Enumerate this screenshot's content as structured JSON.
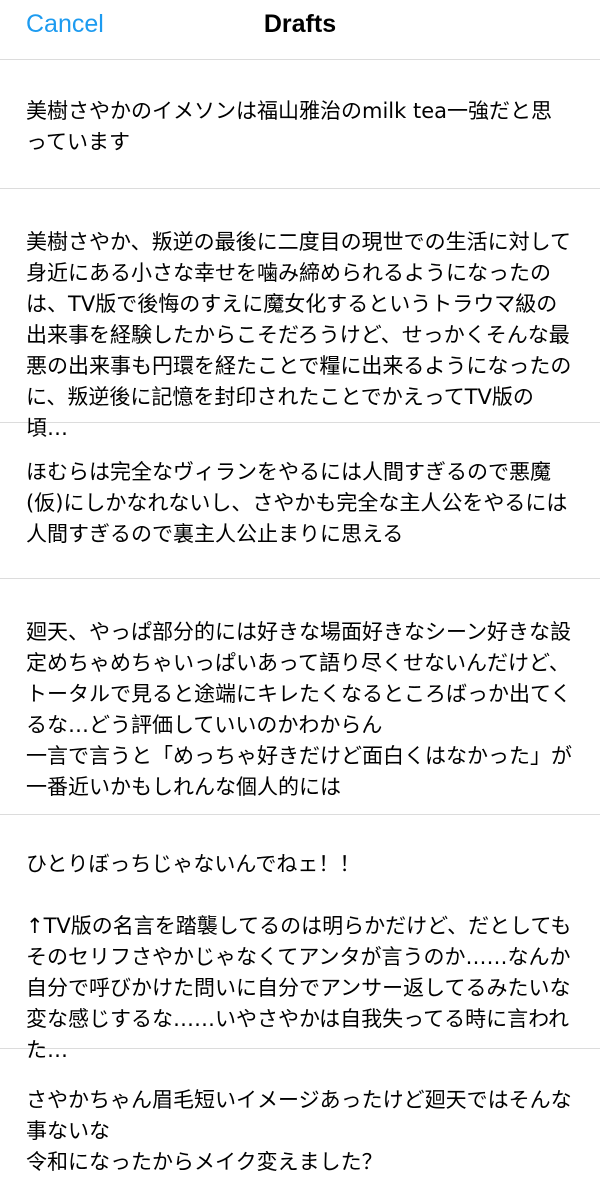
{
  "header": {
    "cancel_label": "Cancel",
    "title": "Drafts"
  },
  "drafts": [
    {
      "text": "美樹さやかのイメソンは福山雅治のmilk tea一強だと思っています"
    },
    {
      "text": "美樹さやか、叛逆の最後に二度目の現世での生活に対して身近にある小さな幸せを噛み締められるようになったのは、TV版で後悔のすえに魔女化するというトラウマ級の出来事を経験したからこそだろうけど、せっかくそんな最悪の出来事も円環を経たことで糧に出来るようになったのに、叛逆後に記憶を封印されたことでかえってTV版の頃…"
    },
    {
      "text": "ほむらは完全なヴィランをやるには人間すぎるので悪魔(仮)にしかなれないし、さやかも完全な主人公をやるには人間すぎるので裏主人公止まりに思える"
    },
    {
      "text": "廻天、やっぱ部分的には好きな場面好きなシーン好きな設定めちゃめちゃいっぱいあって語り尽くせないんだけど、トータルで見ると途端にキレたくなるところばっか出てくるな…どう評価していいのかわからん\n一言で言うと「めっちゃ好きだけど面白くはなかった」が一番近いかもしれんな個人的には"
    },
    {
      "text": "ひとりぼっちじゃないんでねェ！！\n\n↑TV版の名言を踏襲してるのは明らかだけど、だとしてもそのセリフさやかじゃなくてアンタが言うのか……なんか自分で呼びかけた問いに自分でアンサー返してるみたいな変な感じするな……いやさやかは自我失ってる時に言われた…"
    },
    {
      "text": "さやかちゃん眉毛短いイメージあったけど廻天ではそんな事ないな\n令和になったからメイク変えました？"
    }
  ]
}
